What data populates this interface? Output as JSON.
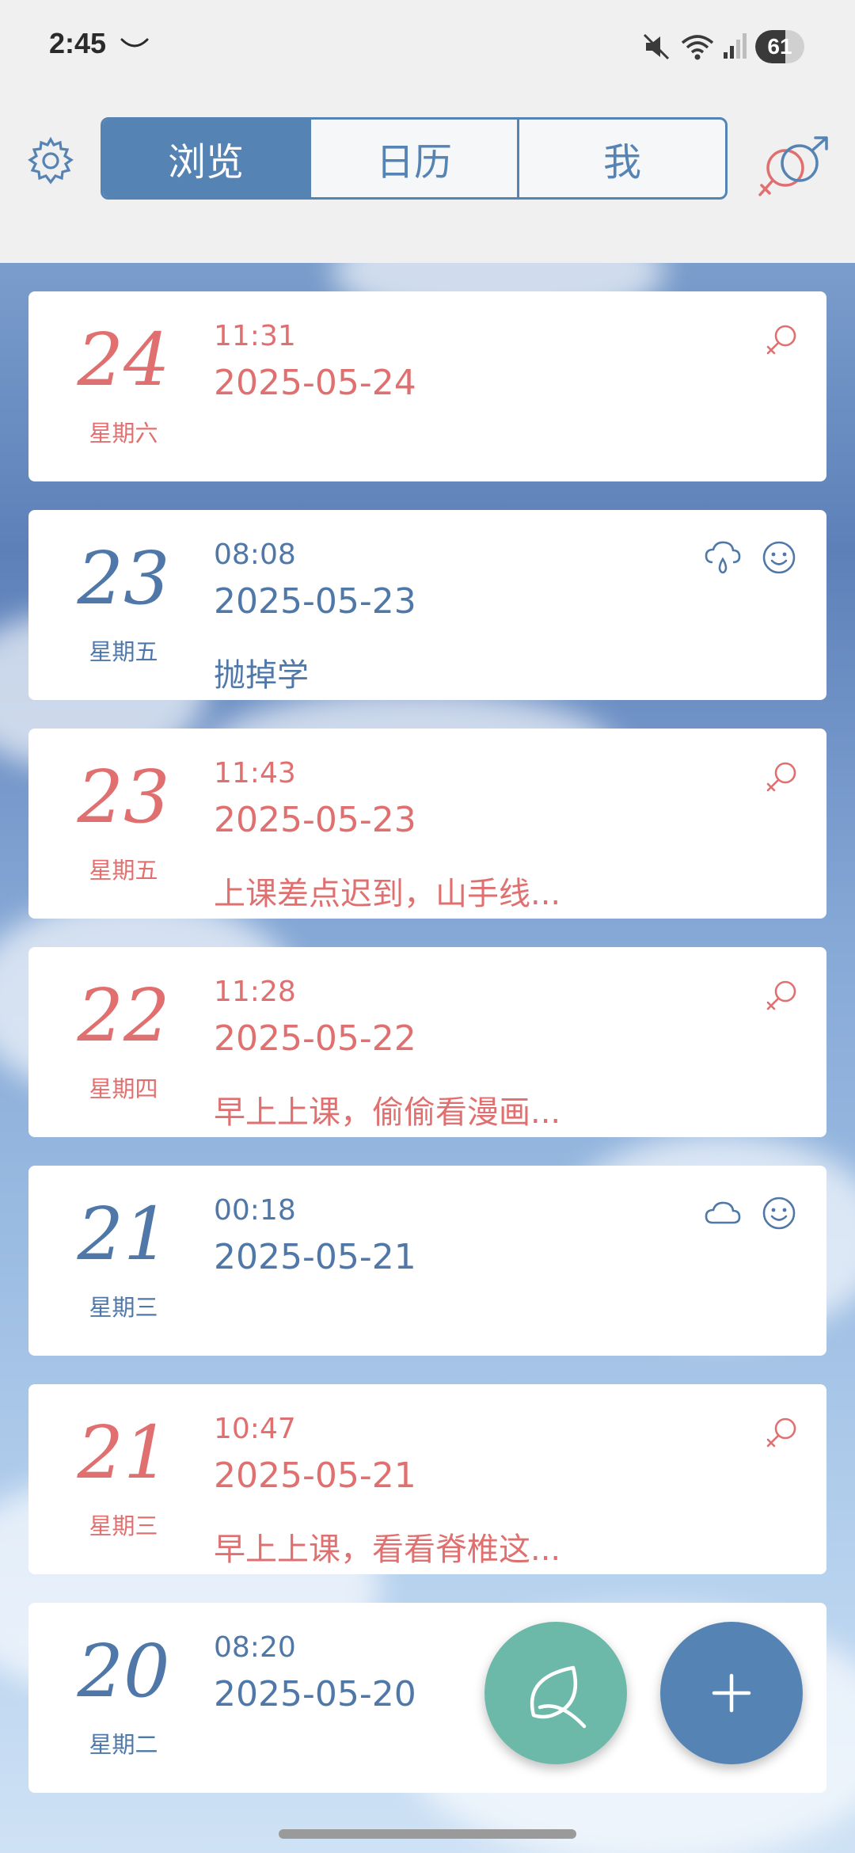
{
  "status_bar": {
    "time": "2:45",
    "battery": "61",
    "battery_level": 0.61,
    "icons": [
      "notification-icon",
      "mute-icon",
      "wifi-icon",
      "signal-icon",
      "battery-icon"
    ]
  },
  "top_bar": {
    "tabs": [
      {
        "label": "浏览",
        "active": true
      },
      {
        "label": "日历",
        "active": false
      },
      {
        "label": "我",
        "active": false
      }
    ]
  },
  "entries": [
    {
      "day": "24",
      "weekday": "星期六",
      "time": "11:31",
      "date": "2025-05-24",
      "note": "",
      "color": "red",
      "icons": [
        "female-icon"
      ]
    },
    {
      "day": "23",
      "weekday": "星期五",
      "time": "08:08",
      "date": "2025-05-23",
      "note": "抛掉学",
      "color": "blue",
      "icons": [
        "rain-icon",
        "smile-icon"
      ]
    },
    {
      "day": "23",
      "weekday": "星期五",
      "time": "11:43",
      "date": "2025-05-23",
      "note": "上课差点迟到，山手线...",
      "color": "red",
      "icons": [
        "female-icon"
      ]
    },
    {
      "day": "22",
      "weekday": "星期四",
      "time": "11:28",
      "date": "2025-05-22",
      "note": "早上上课，偷偷看漫画...",
      "color": "red",
      "icons": [
        "female-icon"
      ]
    },
    {
      "day": "21",
      "weekday": "星期三",
      "time": "00:18",
      "date": "2025-05-21",
      "note": "",
      "color": "blue",
      "icons": [
        "cloud-icon",
        "smile-icon"
      ]
    },
    {
      "day": "21",
      "weekday": "星期三",
      "time": "10:47",
      "date": "2025-05-21",
      "note": "早上上课，看看脊椎这...",
      "color": "red",
      "icons": [
        "female-icon"
      ]
    },
    {
      "day": "20",
      "weekday": "星期二",
      "time": "08:20",
      "date": "2025-05-20",
      "note": "",
      "color": "blue",
      "icons": []
    }
  ],
  "colors": {
    "accent_blue": "#5583b4",
    "accent_red": "#e07070",
    "entry_blue": "#4f78a8",
    "fab_green": "#6cb8a9"
  },
  "fabs": [
    {
      "name": "leaf-icon"
    },
    {
      "name": "add-icon"
    }
  ]
}
